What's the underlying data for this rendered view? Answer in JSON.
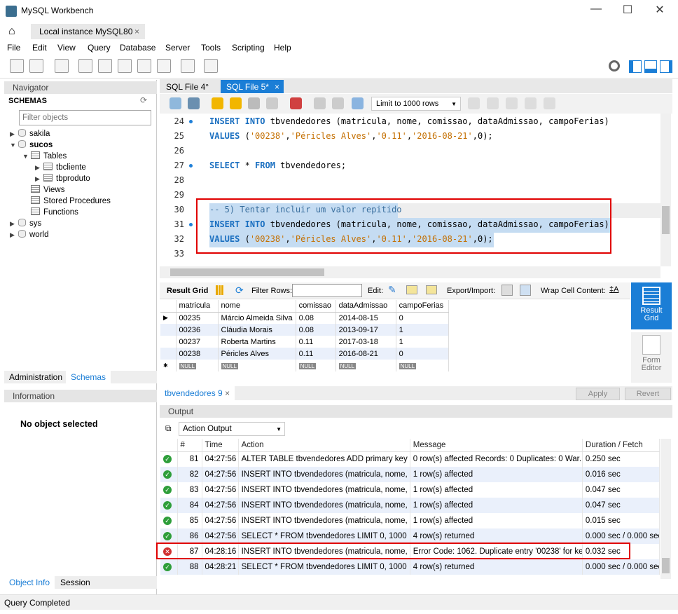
{
  "window": {
    "title": "MySQL Workbench",
    "minimize": "—",
    "maximize": "☐",
    "close": "✕"
  },
  "connection_tab": {
    "label": "Local instance MySQL80",
    "close": "×"
  },
  "menu": [
    "File",
    "Edit",
    "View",
    "Query",
    "Database",
    "Server",
    "Tools",
    "Scripting",
    "Help"
  ],
  "navigator": {
    "header": "Navigator",
    "schemas_label": "SCHEMAS",
    "filter_placeholder": "Filter objects",
    "tree": [
      {
        "label": "sakila",
        "level": 0,
        "icon": "database-icon",
        "expander": "▶"
      },
      {
        "label": "sucos",
        "level": 0,
        "icon": "database-icon",
        "expander": "▼",
        "bold": true
      },
      {
        "label": "Tables",
        "level": 1,
        "icon": "folder-icon",
        "expander": "▼"
      },
      {
        "label": "tbcliente",
        "level": 2,
        "icon": "table-icon",
        "expander": "▶"
      },
      {
        "label": "tbproduto",
        "level": 2,
        "icon": "table-icon",
        "expander": "▶"
      },
      {
        "label": "Views",
        "level": 1,
        "icon": "folder-icon",
        "expander": ""
      },
      {
        "label": "Stored Procedures",
        "level": 1,
        "icon": "folder-icon",
        "expander": ""
      },
      {
        "label": "Functions",
        "level": 1,
        "icon": "folder-icon",
        "expander": ""
      },
      {
        "label": "sys",
        "level": 0,
        "icon": "database-icon",
        "expander": "▶"
      },
      {
        "label": "world",
        "level": 0,
        "icon": "database-icon",
        "expander": "▶"
      }
    ],
    "tabs": [
      "Administration",
      "Schemas"
    ],
    "active_tab": "Schemas"
  },
  "information": {
    "header": "Information",
    "empty_text": "No object selected",
    "tabs": [
      "Object Info",
      "Session"
    ]
  },
  "sql_tabs": [
    {
      "label": "SQL File 4°",
      "active": false
    },
    {
      "label": "SQL File 5*",
      "active": true,
      "close": "×"
    }
  ],
  "editor_toolbar": {
    "limit": "Limit to 1000 rows"
  },
  "code_lines": [
    {
      "n": "24",
      "dot": true,
      "text": "INSERT INTO tbvendedores (matricula, nome, comissao, dataAdmissao, campoFerias)"
    },
    {
      "n": "25",
      "dot": false,
      "text": "VALUES ('00238','Péricles Alves','0.11','2016-08-21',0);"
    },
    {
      "n": "26",
      "dot": false,
      "text": ""
    },
    {
      "n": "27",
      "dot": true,
      "text": "SELECT * FROM tbvendedores;"
    },
    {
      "n": "28",
      "dot": false,
      "text": ""
    },
    {
      "n": "29",
      "dot": false,
      "text": ""
    },
    {
      "n": "30",
      "dot": false,
      "text": "-- 5) Tentar incluir um valor repitido",
      "selected": true
    },
    {
      "n": "31",
      "dot": true,
      "text": "INSERT INTO tbvendedores (matricula, nome, comissao, dataAdmissao, campoFerias)",
      "selected": true
    },
    {
      "n": "32",
      "dot": false,
      "text": "VALUES ('00238','Péricles Alves','0.11','2016-08-21',0);",
      "selected": true
    },
    {
      "n": "33",
      "dot": false,
      "text": ""
    }
  ],
  "result_toolbar": {
    "result_grid": "Result Grid",
    "filter_rows": "Filter Rows:",
    "edit": "Edit:",
    "export_import": "Export/Import:",
    "wrap": "Wrap Cell Content:"
  },
  "result_grid": {
    "columns": [
      "matricula",
      "nome",
      "comissao",
      "dataAdmissao",
      "campoFerias"
    ],
    "rows": [
      [
        "00235",
        "Márcio Almeida Silva",
        "0.08",
        "2014-08-15",
        "0"
      ],
      [
        "00236",
        "Cláudia Morais",
        "0.08",
        "2013-09-17",
        "1"
      ],
      [
        "00237",
        "Roberta Martins",
        "0.11",
        "2017-03-18",
        "1"
      ],
      [
        "00238",
        "Péricles Alves",
        "0.11",
        "2016-08-21",
        "0"
      ]
    ],
    "null_label": "NULL"
  },
  "side_panel": {
    "result_grid": "Result Grid",
    "form_editor": "Form Editor"
  },
  "result_tab": "tbvendedores 9",
  "apply": "Apply",
  "revert": "Revert",
  "output": {
    "header": "Output",
    "selector": "Action Output",
    "columns": [
      "#",
      "Time",
      "Action",
      "Message",
      "Duration / Fetch"
    ],
    "rows": [
      {
        "status": "ok",
        "n": "81",
        "time": "04:27:56",
        "action": "ALTER TABLE tbvendedores ADD primary key (...",
        "message": "0 row(s) affected Records: 0  Duplicates: 0  War...",
        "duration": "0.250 sec"
      },
      {
        "status": "ok",
        "n": "82",
        "time": "04:27:56",
        "action": "INSERT INTO tbvendedores (matricula, nome, ...",
        "message": "1 row(s) affected",
        "duration": "0.016 sec"
      },
      {
        "status": "ok",
        "n": "83",
        "time": "04:27:56",
        "action": "INSERT INTO tbvendedores (matricula, nome, ...",
        "message": "1 row(s) affected",
        "duration": "0.047 sec"
      },
      {
        "status": "ok",
        "n": "84",
        "time": "04:27:56",
        "action": "INSERT INTO tbvendedores (matricula, nome, ...",
        "message": "1 row(s) affected",
        "duration": "0.047 sec"
      },
      {
        "status": "ok",
        "n": "85",
        "time": "04:27:56",
        "action": "INSERT INTO tbvendedores (matricula, nome, ...",
        "message": "1 row(s) affected",
        "duration": "0.015 sec"
      },
      {
        "status": "ok",
        "n": "86",
        "time": "04:27:56",
        "action": "SELECT * FROM tbvendedores LIMIT 0, 1000",
        "message": "4 row(s) returned",
        "duration": "0.000 sec / 0.000 sec"
      },
      {
        "status": "error",
        "n": "87",
        "time": "04:28:16",
        "action": "INSERT INTO tbvendedores (matricula, nome, ...",
        "message": "Error Code: 1062. Duplicate entry '00238' for key...",
        "duration": "0.032 sec"
      },
      {
        "status": "ok",
        "n": "88",
        "time": "04:28:21",
        "action": "SELECT * FROM tbvendedores LIMIT 0, 1000",
        "message": "4 row(s) returned",
        "duration": "0.000 sec / 0.000 sec"
      }
    ]
  },
  "status_bar": "Query Completed",
  "colors": {
    "accent": "#1b7ed6",
    "highlight_box": "#e00000",
    "selection": "#c5dcf2"
  }
}
